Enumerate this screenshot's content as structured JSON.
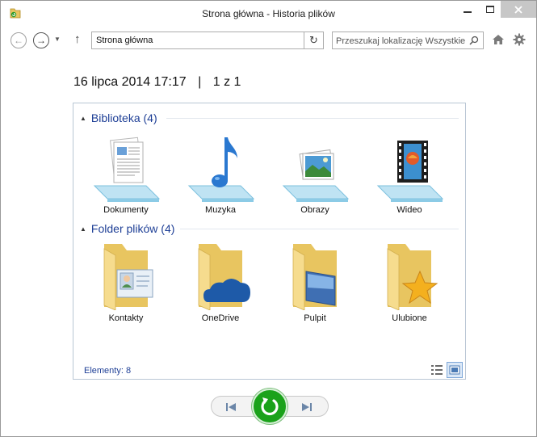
{
  "window": {
    "title": "Strona główna - Historia plików",
    "icons": [
      "file-history-app-icon",
      "minimize-icon",
      "maximize-icon",
      "close-icon"
    ]
  },
  "navbar": {
    "address": "Strona główna",
    "search_placeholder": "Przeszukaj lokalizację Wszystkie",
    "icons": [
      "back-arrow-icon",
      "forward-arrow-icon",
      "chevron-down-icon",
      "up-arrow-icon",
      "refresh-icon",
      "search-icon",
      "home-icon",
      "gear-icon"
    ]
  },
  "snapshot": {
    "date": "16 lipca 2014 17:17",
    "separator": "|",
    "position": "1 z 1"
  },
  "groups": [
    {
      "title": "Biblioteka (4)",
      "items": [
        {
          "label": "Dokumenty",
          "icon": "documents-library-icon"
        },
        {
          "label": "Muzyka",
          "icon": "music-library-icon"
        },
        {
          "label": "Obrazy",
          "icon": "pictures-library-icon"
        },
        {
          "label": "Wideo",
          "icon": "videos-library-icon"
        }
      ]
    },
    {
      "title": "Folder plików (4)",
      "items": [
        {
          "label": "Kontakty",
          "icon": "contacts-folder-icon"
        },
        {
          "label": "OneDrive",
          "icon": "onedrive-folder-icon"
        },
        {
          "label": "Pulpit",
          "icon": "desktop-folder-icon"
        },
        {
          "label": "Ulubione",
          "icon": "favorites-folder-icon"
        }
      ]
    }
  ],
  "status": {
    "items_count": "Elementy: 8"
  },
  "view": {
    "active_mode": "large-icons",
    "icons": [
      "details-view-icon",
      "large-icons-view-icon"
    ]
  },
  "controls": {
    "icons": [
      "previous-version-icon",
      "restore-icon",
      "next-version-icon"
    ]
  },
  "colors": {
    "accent_blue": "#1e3f96",
    "restore_green": "#1aa21a",
    "folder_yellow": "#f2d478"
  }
}
